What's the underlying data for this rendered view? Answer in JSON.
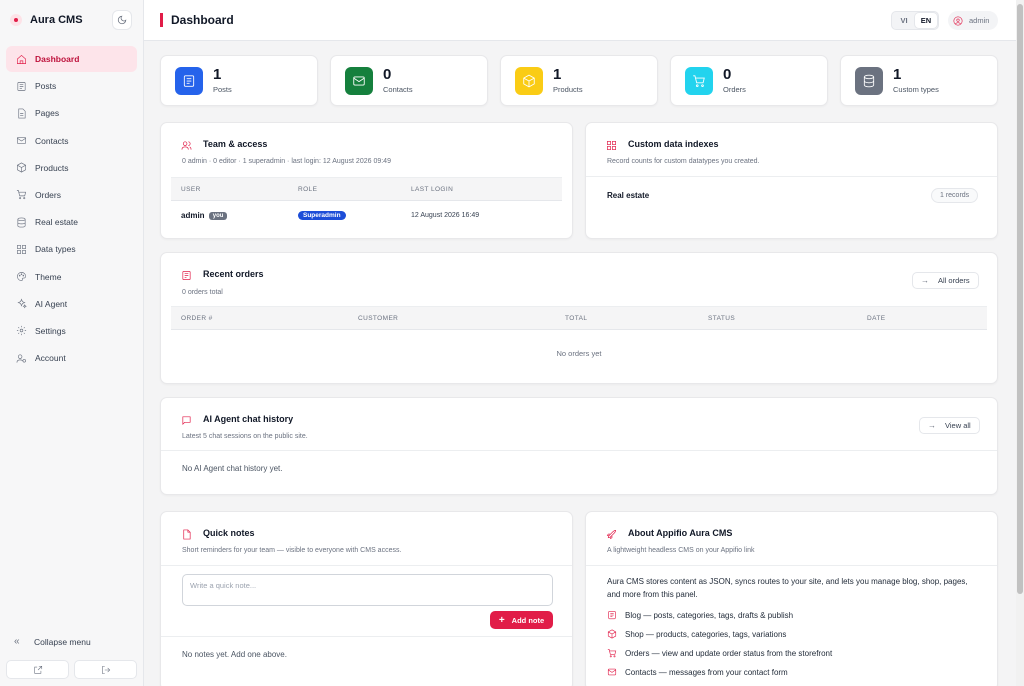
{
  "brand": {
    "name": "Aura CMS"
  },
  "sidebar": {
    "items": [
      {
        "label": "Dashboard",
        "icon": "home-icon",
        "active": true
      },
      {
        "label": "Posts",
        "icon": "posts-icon"
      },
      {
        "label": "Pages",
        "icon": "pages-icon"
      },
      {
        "label": "Contacts",
        "icon": "mail-icon"
      },
      {
        "label": "Products",
        "icon": "box-icon"
      },
      {
        "label": "Orders",
        "icon": "cart-icon"
      },
      {
        "label": "Real estate",
        "icon": "database-icon"
      },
      {
        "label": "Data types",
        "icon": "grid-icon"
      },
      {
        "label": "Theme",
        "icon": "palette-icon"
      },
      {
        "label": "AI Agent",
        "icon": "sparkles-icon"
      },
      {
        "label": "Settings",
        "icon": "gear-icon"
      },
      {
        "label": "Account",
        "icon": "user-cog-icon"
      }
    ],
    "collapse_label": "Collapse menu"
  },
  "topbar": {
    "title": "Dashboard",
    "lang_vi": "VI",
    "lang_en": "EN",
    "user": "admin"
  },
  "stats": [
    {
      "value": "1",
      "label": "Posts",
      "color": "#2563eb",
      "icon": "posts-icon"
    },
    {
      "value": "0",
      "label": "Contacts",
      "color": "#15803d",
      "icon": "mail-icon"
    },
    {
      "value": "1",
      "label": "Products",
      "color": "#facc15",
      "icon": "box-icon"
    },
    {
      "value": "0",
      "label": "Orders",
      "color": "#22d3ee",
      "icon": "cart-icon"
    },
    {
      "value": "1",
      "label": "Custom types",
      "color": "#6b7280",
      "icon": "database-icon"
    }
  ],
  "team": {
    "title": "Team & access",
    "subtitle": "0 admin · 0 editor · 1 superadmin · last login: 12 August 2026 09:49",
    "columns": [
      "USER",
      "ROLE",
      "LAST LOGIN"
    ],
    "rows": [
      {
        "user": "admin",
        "you": "you",
        "role": "Superadmin",
        "last_login": "12 August 2026 16:49"
      }
    ]
  },
  "indexes": {
    "title": "Custom data indexes",
    "subtitle": "Record counts for custom datatypes you created.",
    "items": [
      {
        "name": "Real estate",
        "count": "1 records"
      }
    ]
  },
  "orders": {
    "title": "Recent orders",
    "subtitle": "0 orders total",
    "button": "All orders",
    "columns": [
      "ORDER #",
      "CUSTOMER",
      "TOTAL",
      "STATUS",
      "DATE"
    ],
    "empty": "No orders yet"
  },
  "chat": {
    "title": "AI Agent chat history",
    "subtitle": "Latest 5 chat sessions on the public site.",
    "button": "View all",
    "empty": "No AI Agent chat history yet."
  },
  "notes": {
    "title": "Quick notes",
    "subtitle": "Short reminders for your team — visible to everyone with CMS access.",
    "placeholder": "Write a quick note...",
    "add_label": "Add note",
    "empty": "No notes yet. Add one above."
  },
  "about": {
    "title": "About Appifio Aura CMS",
    "subtitle": "A lightweight headless CMS on your Appifio link",
    "text": "Aura CMS stores content as JSON, syncs routes to your site, and lets you manage blog, shop, pages, and more from this panel.",
    "features": [
      "Blog — posts, categories, tags, drafts & publish",
      "Shop — products, categories, tags, variations",
      "Orders — view and update order status from the storefront",
      "Contacts — messages from your contact form"
    ]
  }
}
